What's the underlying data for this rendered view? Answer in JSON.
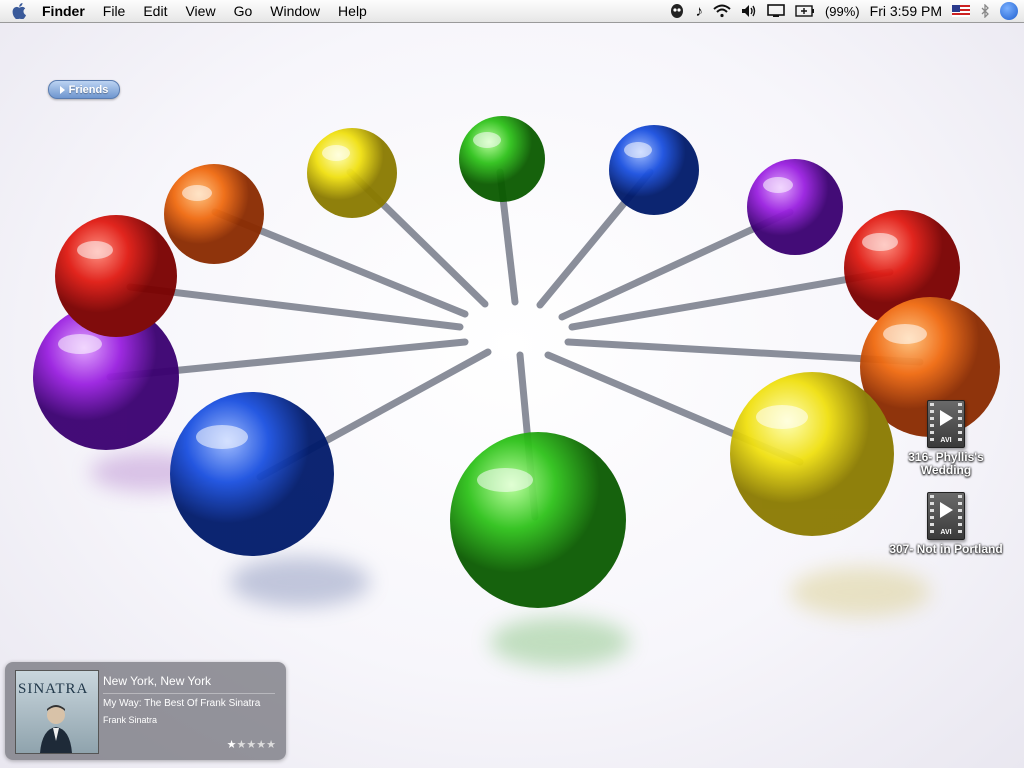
{
  "menubar": {
    "apple_icon": "apple-icon",
    "app_name": "Finder",
    "menus": [
      "File",
      "Edit",
      "View",
      "Go",
      "Window",
      "Help"
    ],
    "status": {
      "battery_percent": "(99%)",
      "clock": "Fri 3:59 PM"
    }
  },
  "widgets": {
    "friends_label": "Friends"
  },
  "desktop": {
    "icons": [
      {
        "label": "316- Phyllis's Wedding",
        "type_tag": "AVI"
      },
      {
        "label": "307- Not in Portland",
        "type_tag": "AVI"
      }
    ]
  },
  "now_playing": {
    "cover_text": "SINATRA",
    "song": "New York, New York",
    "album": "My Way: The Best Of Frank Sinatra",
    "artist": "Frank Sinatra",
    "rating": 1,
    "rating_max": 5
  }
}
